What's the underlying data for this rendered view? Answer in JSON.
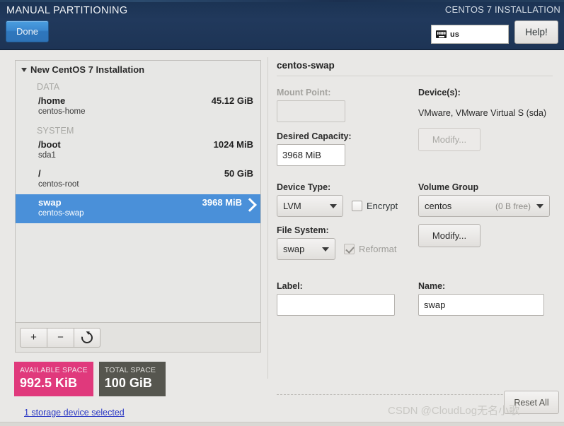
{
  "header": {
    "title": "MANUAL PARTITIONING",
    "product_title": "CENTOS 7 INSTALLATION",
    "done_label": "Done",
    "help_label": "Help!",
    "keyboard_layout": "us"
  },
  "partition_list": {
    "group_label": "New CentOS 7 Installation",
    "sections": [
      {
        "label": "DATA",
        "rows": [
          {
            "mount": "/home",
            "device": "centos-home",
            "size": "45.12 GiB",
            "selected": false
          }
        ]
      },
      {
        "label": "SYSTEM",
        "rows": [
          {
            "mount": "/boot",
            "device": "sda1",
            "size": "1024 MiB",
            "selected": false
          },
          {
            "mount": "/",
            "device": "centos-root",
            "size": "50 GiB",
            "selected": false
          },
          {
            "mount": "swap",
            "device": "centos-swap",
            "size": "3968 MiB",
            "selected": true
          }
        ]
      }
    ],
    "toolbar": {
      "add_label": "+",
      "remove_label": "−",
      "reload_label": ""
    }
  },
  "space_summary": {
    "available_caption": "AVAILABLE SPACE",
    "available_value": "992.5 KiB",
    "total_caption": "TOTAL SPACE",
    "total_value": "100 GiB",
    "storage_link": "1 storage device selected",
    "available_color": "#e0397c",
    "total_color": "#56564f"
  },
  "detail": {
    "title": "centos-swap",
    "mount_point_label": "Mount Point:",
    "mount_point_value": "",
    "desired_capacity_label": "Desired Capacity:",
    "desired_capacity_value": "3968 MiB",
    "device_type_label": "Device Type:",
    "device_type_value": "LVM",
    "encrypt_label": "Encrypt",
    "encrypt_checked": false,
    "file_system_label": "File System:",
    "file_system_value": "swap",
    "reformat_label": "Reformat",
    "reformat_checked": true,
    "devices_label": "Device(s):",
    "devices_value": "VMware, VMware Virtual S (sda)",
    "devices_modify_label": "Modify...",
    "volume_group_label": "Volume Group",
    "volume_group_value": "centos",
    "volume_group_free": "(0 B free)",
    "volume_group_modify_label": "Modify...",
    "label_label": "Label:",
    "label_value": "",
    "name_label": "Name:",
    "name_value": "swap"
  },
  "footer": {
    "reset_all_label": "Reset All",
    "watermark": "CSDN @CloudLog无名小歌"
  }
}
